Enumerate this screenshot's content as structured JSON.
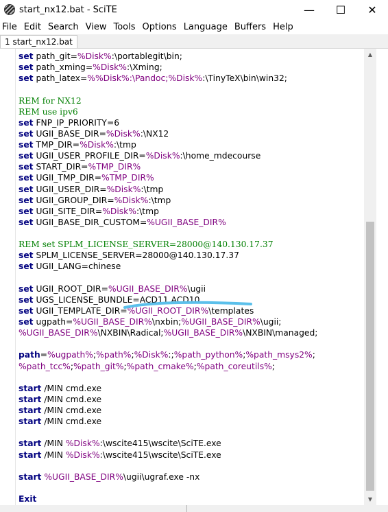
{
  "window": {
    "title": "start_nx12.bat - SciTE",
    "app_icon": "scite-icon",
    "buttons": {
      "minimize": "—",
      "maximize": "☐",
      "close": "✕"
    }
  },
  "menu": [
    "File",
    "Edit",
    "Search",
    "View",
    "Tools",
    "Options",
    "Language",
    "Buffers",
    "Help"
  ],
  "tab": {
    "label": "1 start_nx12.bat"
  },
  "highlight_color": "#5bc0eb",
  "code_lines": [
    [
      {
        "t": "set",
        "c": "kw"
      },
      {
        "t": " path_git="
      },
      {
        "t": "%Disk%",
        "c": "var"
      },
      {
        "t": ":\\portablegit\\bin;"
      }
    ],
    [
      {
        "t": "set",
        "c": "kw"
      },
      {
        "t": " path_xming="
      },
      {
        "t": "%Disk%",
        "c": "var"
      },
      {
        "t": ":\\Xming;"
      }
    ],
    [
      {
        "t": "set",
        "c": "kw"
      },
      {
        "t": " path_latex="
      },
      {
        "t": "%%Disk%",
        "c": "var"
      },
      {
        "t": ":\\Pandoc;",
        "c": "var"
      },
      {
        "t": "%Disk%",
        "c": "var"
      },
      {
        "t": ":\\TinyTeX\\bin\\win32;"
      }
    ],
    [],
    [
      {
        "t": "REM for NX12",
        "c": "comment"
      }
    ],
    [
      {
        "t": "REM use ipv6",
        "c": "comment"
      }
    ],
    [
      {
        "t": "set",
        "c": "kw"
      },
      {
        "t": " FNP_IP_PRIORITY=6"
      }
    ],
    [
      {
        "t": "set",
        "c": "kw"
      },
      {
        "t": " UGII_BASE_DIR="
      },
      {
        "t": "%Disk%",
        "c": "var"
      },
      {
        "t": ":\\NX12"
      }
    ],
    [
      {
        "t": "set",
        "c": "kw"
      },
      {
        "t": " TMP_DIR="
      },
      {
        "t": "%Disk%",
        "c": "var"
      },
      {
        "t": ":\\tmp"
      }
    ],
    [
      {
        "t": "set",
        "c": "kw"
      },
      {
        "t": " UGII_USER_PROFILE_DIR="
      },
      {
        "t": "%Disk%",
        "c": "var"
      },
      {
        "t": ":\\home_mdecourse"
      }
    ],
    [
      {
        "t": "set",
        "c": "kw"
      },
      {
        "t": " START_DIR="
      },
      {
        "t": "%TMP_DIR%",
        "c": "var"
      }
    ],
    [
      {
        "t": "set",
        "c": "kw"
      },
      {
        "t": " UGII_TMP_DIR="
      },
      {
        "t": "%TMP_DIR%",
        "c": "var"
      }
    ],
    [
      {
        "t": "set",
        "c": "kw"
      },
      {
        "t": " UGII_USER_DIR="
      },
      {
        "t": "%Disk%",
        "c": "var"
      },
      {
        "t": ":\\tmp"
      }
    ],
    [
      {
        "t": "set",
        "c": "kw"
      },
      {
        "t": " UGII_GROUP_DIR="
      },
      {
        "t": "%Disk%",
        "c": "var"
      },
      {
        "t": ":\\tmp"
      }
    ],
    [
      {
        "t": "set",
        "c": "kw"
      },
      {
        "t": " UGII_SITE_DIR="
      },
      {
        "t": "%Disk%",
        "c": "var"
      },
      {
        "t": ":\\tmp"
      }
    ],
    [
      {
        "t": "set",
        "c": "kw"
      },
      {
        "t": " UGII_BASE_DIR_CUSTOM="
      },
      {
        "t": "%UGII_BASE_DIR%",
        "c": "var"
      }
    ],
    [],
    [
      {
        "t": "REM set SPLM_LICENSE_SERVER=28000@140.130.17.37",
        "c": "comment"
      }
    ],
    [
      {
        "t": "set",
        "c": "kw"
      },
      {
        "t": " SPLM_LICENSE_SERVER=28000@140.130.17.37"
      }
    ],
    [
      {
        "t": "set",
        "c": "kw"
      },
      {
        "t": " UGII_LANG=chinese"
      }
    ],
    [],
    [
      {
        "t": "set",
        "c": "kw"
      },
      {
        "t": " UGII_ROOT_DIR="
      },
      {
        "t": "%UGII_BASE_DIR%",
        "c": "var"
      },
      {
        "t": "\\ugii"
      }
    ],
    [
      {
        "t": "set",
        "c": "kw"
      },
      {
        "t": " UGS_LICENSE_BUNDLE=ACD11,ACD10"
      }
    ],
    [
      {
        "t": "set",
        "c": "kw"
      },
      {
        "t": " UGII_TEMPLATE_DIR="
      },
      {
        "t": "%UGII_ROOT_DIR%",
        "c": "var"
      },
      {
        "t": "\\templates"
      }
    ],
    [
      {
        "t": "set",
        "c": "kw"
      },
      {
        "t": " ugpath="
      },
      {
        "t": "%UGII_BASE_DIR%",
        "c": "var"
      },
      {
        "t": "\\nxbin;"
      },
      {
        "t": "%UGII_BASE_DIR%",
        "c": "var"
      },
      {
        "t": "\\ugii;"
      }
    ],
    [
      {
        "t": "%UGII_BASE_DIR%",
        "c": "var"
      },
      {
        "t": "\\NXBIN\\Radical;"
      },
      {
        "t": "%UGII_BASE_DIR%",
        "c": "var"
      },
      {
        "t": "\\NXBIN\\managed;"
      }
    ],
    [],
    [
      {
        "t": "path",
        "c": "kw"
      },
      {
        "t": "="
      },
      {
        "t": "%ugpath%",
        "c": "var"
      },
      {
        "t": ";"
      },
      {
        "t": "%path%",
        "c": "var"
      },
      {
        "t": ";"
      },
      {
        "t": "%Disk%",
        "c": "var"
      },
      {
        "t": ":;"
      },
      {
        "t": "%path_python%",
        "c": "var"
      },
      {
        "t": ";"
      },
      {
        "t": "%path_msys2%",
        "c": "var"
      },
      {
        "t": ";"
      }
    ],
    [
      {
        "t": "%path_tcc%",
        "c": "var"
      },
      {
        "t": ";"
      },
      {
        "t": "%path_git%",
        "c": "var"
      },
      {
        "t": ";"
      },
      {
        "t": "%path_cmake%",
        "c": "var"
      },
      {
        "t": ";"
      },
      {
        "t": "%path_coreutils%",
        "c": "var"
      },
      {
        "t": ";"
      }
    ],
    [],
    [
      {
        "t": "start",
        "c": "kw"
      },
      {
        "t": " /MIN cmd.exe"
      }
    ],
    [
      {
        "t": "start",
        "c": "kw"
      },
      {
        "t": " /MIN cmd.exe"
      }
    ],
    [
      {
        "t": "start",
        "c": "kw"
      },
      {
        "t": " /MIN cmd.exe"
      }
    ],
    [
      {
        "t": "start",
        "c": "kw"
      },
      {
        "t": " /MIN cmd.exe"
      }
    ],
    [],
    [
      {
        "t": "start",
        "c": "kw"
      },
      {
        "t": " /MIN "
      },
      {
        "t": "%Disk%",
        "c": "var"
      },
      {
        "t": ":\\wscite415\\wscite\\SciTE.exe"
      }
    ],
    [
      {
        "t": "start",
        "c": "kw"
      },
      {
        "t": " /MIN "
      },
      {
        "t": "%Disk%",
        "c": "var"
      },
      {
        "t": ":\\wscite415\\wscite\\SciTE.exe"
      }
    ],
    [],
    [
      {
        "t": "start",
        "c": "kw"
      },
      {
        "t": " "
      },
      {
        "t": "%UGII_BASE_DIR%",
        "c": "var"
      },
      {
        "t": "\\ugii\\ugraf.exe -nx"
      }
    ],
    [],
    [
      {
        "t": "Exit",
        "c": "kw"
      }
    ]
  ]
}
